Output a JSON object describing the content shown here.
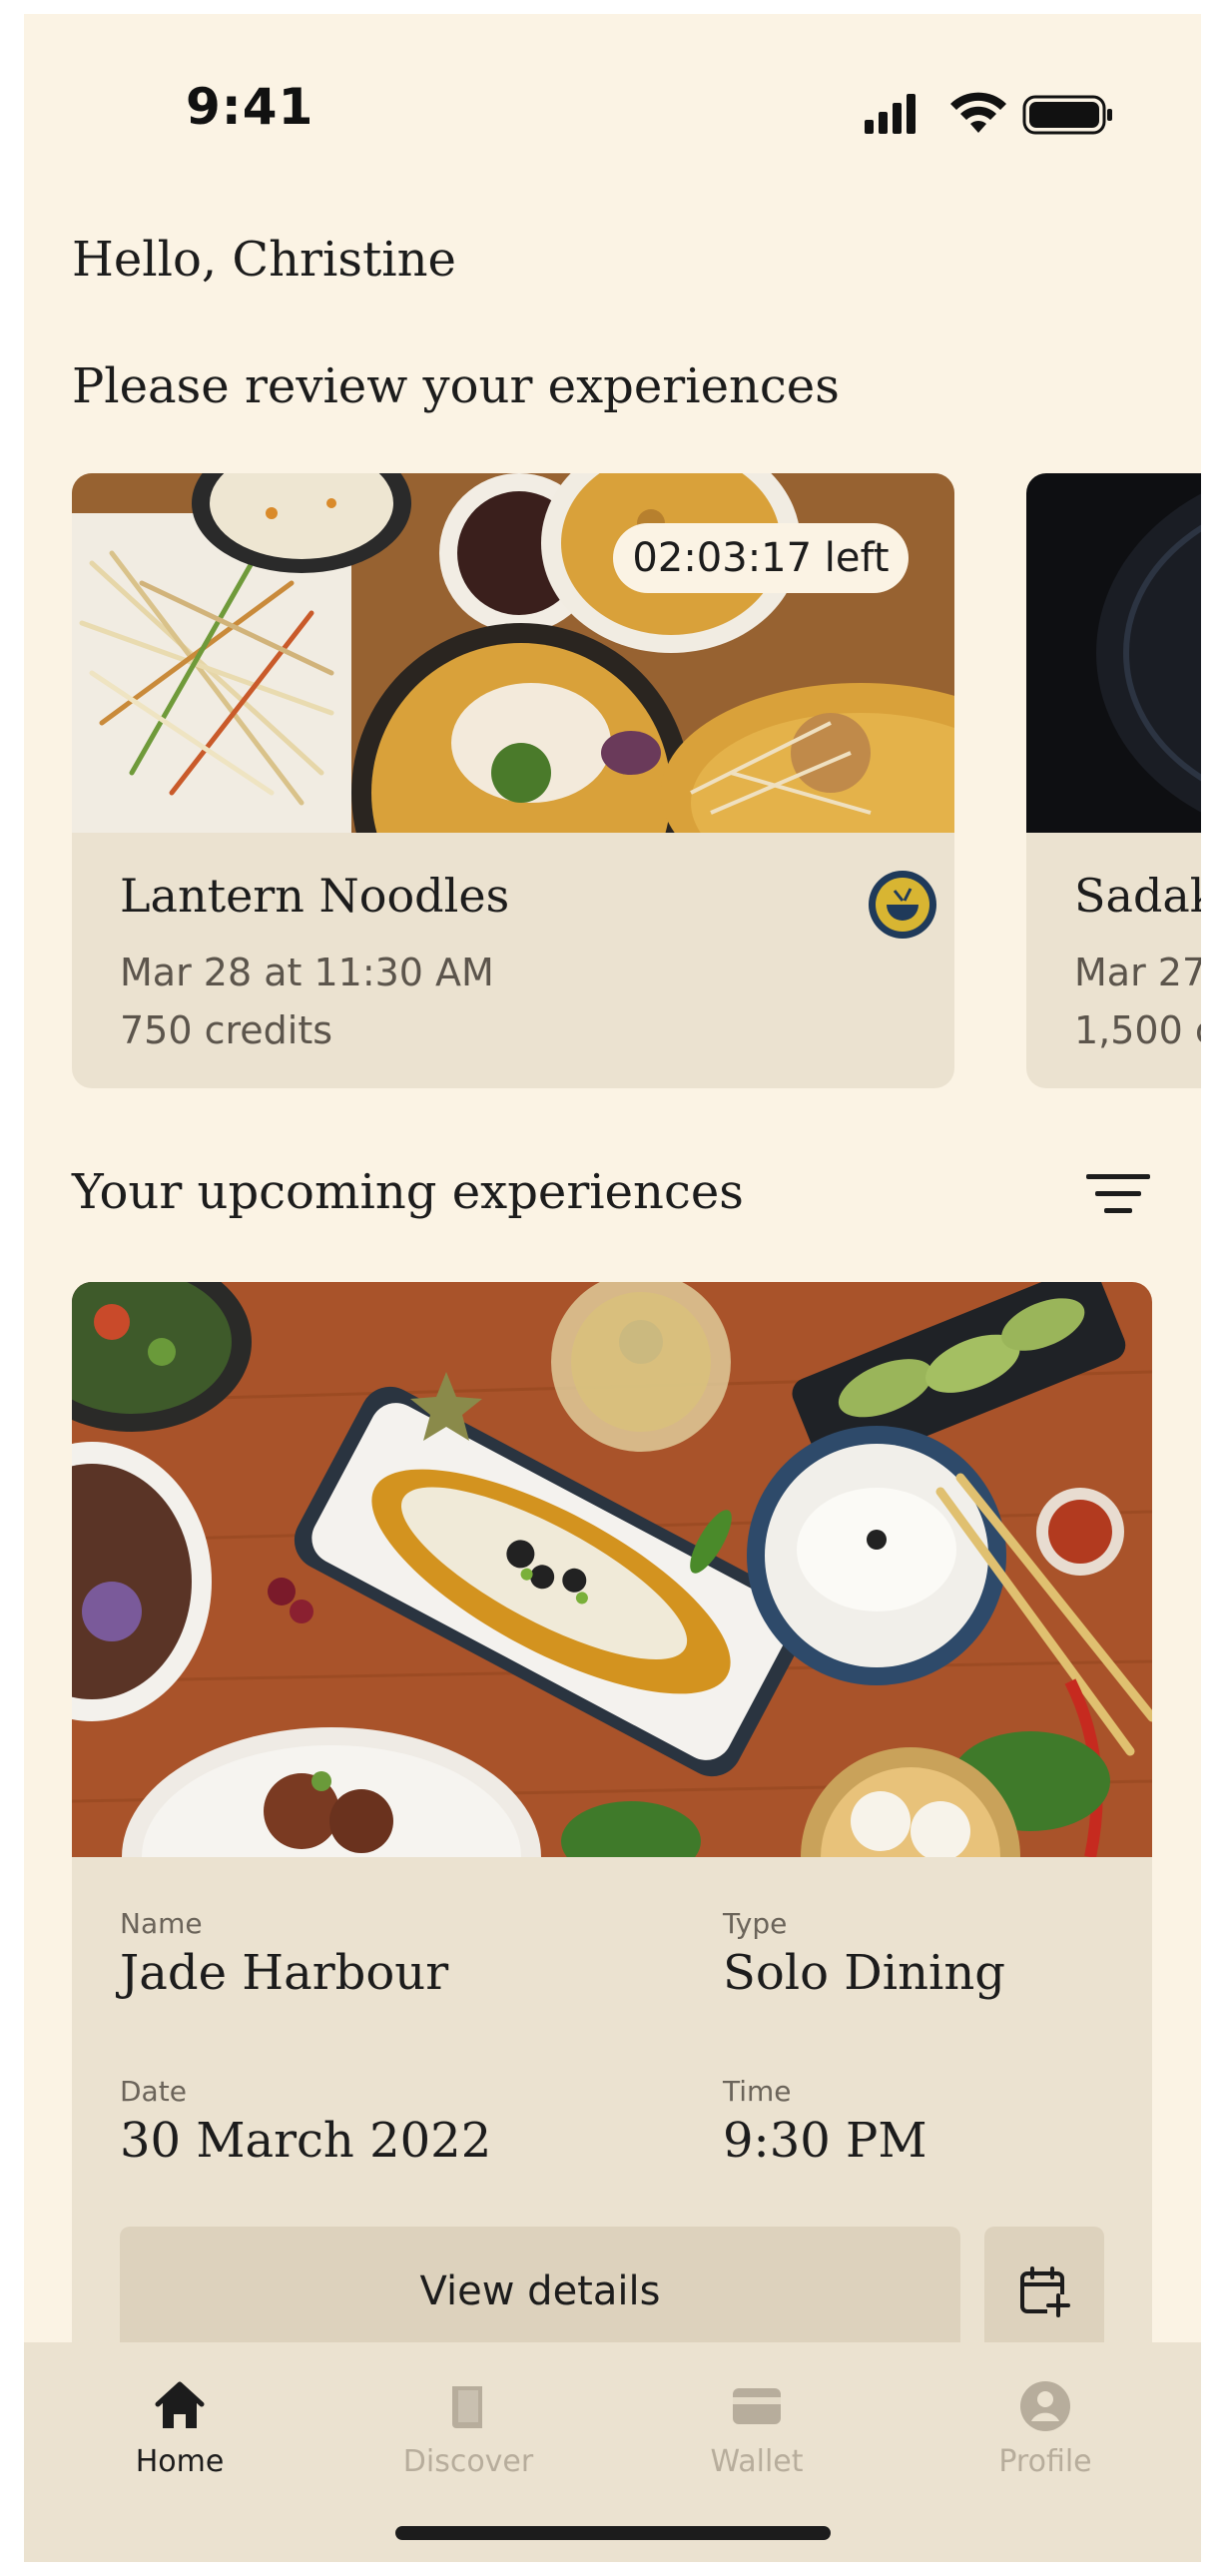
{
  "status_bar": {
    "time": "9:41"
  },
  "greeting": "Hello, Christine",
  "review_section": {
    "title": "Please review your experiences",
    "cards": [
      {
        "timer": "02:03:17 left",
        "name": "Lantern Noodles",
        "date": "Mar 28 at 11:30 AM",
        "credits": "750 credits"
      },
      {
        "name": "Sadak",
        "date": "Mar 27",
        "credits": "1,500 c"
      }
    ]
  },
  "upcoming_section": {
    "title": "Your upcoming experiences",
    "card": {
      "name_label": "Name",
      "name": "Jade Harbour",
      "type_label": "Type",
      "type": "Solo Dining",
      "date_label": "Date",
      "date": "30 March 2022",
      "time_label": "Time",
      "time": "9:30 PM",
      "view_button": "View details"
    }
  },
  "tabbar": {
    "items": [
      {
        "label": "Home",
        "icon": "home-icon",
        "active": true
      },
      {
        "label": "Discover",
        "icon": "book-icon",
        "active": false
      },
      {
        "label": "Wallet",
        "icon": "wallet-icon",
        "active": false
      },
      {
        "label": "Profile",
        "icon": "profile-icon",
        "active": false
      }
    ]
  },
  "colors": {
    "background": "#fbf3e4",
    "card": "#ebe2d0",
    "button": "#ddd2bd",
    "text": "#1c1c1c",
    "inactive_tab": "#b7ad9c"
  }
}
